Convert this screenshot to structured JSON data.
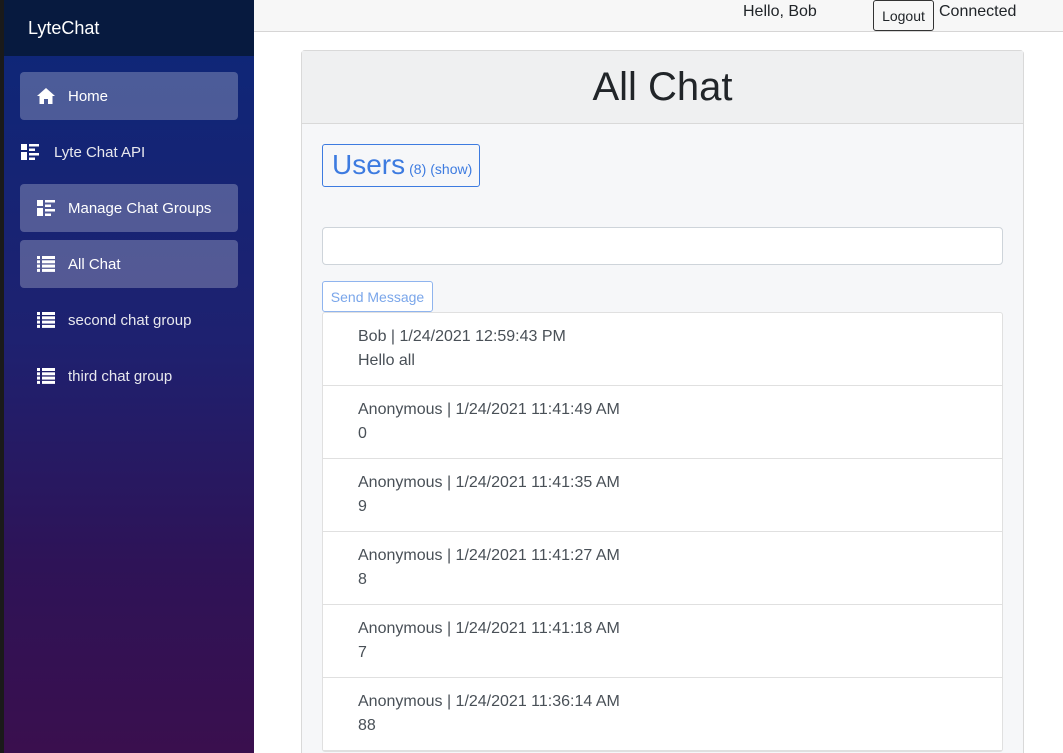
{
  "app": {
    "brand": "LyteChat"
  },
  "sidebar": {
    "items": [
      {
        "label": "Home",
        "icon": "home-icon"
      },
      {
        "label": "Lyte Chat API",
        "icon": "dashboard-icon"
      },
      {
        "label": "Manage Chat Groups",
        "icon": "dashboard-icon"
      },
      {
        "label": "All Chat",
        "icon": "list-icon"
      },
      {
        "label": "second chat group",
        "icon": "list-icon"
      },
      {
        "label": "third chat group",
        "icon": "list-icon"
      }
    ]
  },
  "header": {
    "greeting": "Hello, Bob",
    "logout_label": "Logout",
    "status": "Connected"
  },
  "main": {
    "title": "All Chat",
    "users": {
      "label": "Users",
      "count": "(8)",
      "show": "(show)"
    },
    "message_input": {
      "value": "",
      "placeholder": ""
    },
    "send_label": "Send Message",
    "messages": [
      {
        "meta": "Bob | 1/24/2021 12:59:43 PM",
        "text": "Hello all"
      },
      {
        "meta": "Anonymous | 1/24/2021 11:41:49 AM",
        "text": "0"
      },
      {
        "meta": "Anonymous | 1/24/2021 11:41:35 AM",
        "text": "9"
      },
      {
        "meta": "Anonymous | 1/24/2021 11:41:27 AM",
        "text": "8"
      },
      {
        "meta": "Anonymous | 1/24/2021 11:41:18 AM",
        "text": "7"
      },
      {
        "meta": "Anonymous | 1/24/2021 11:36:14 AM",
        "text": "88"
      }
    ]
  },
  "colors": {
    "sidebar_top": "#0c2779",
    "sidebar_bottom": "#3a0f4e",
    "brand_bar": "#071a3f",
    "primary": "#3d7be0"
  }
}
